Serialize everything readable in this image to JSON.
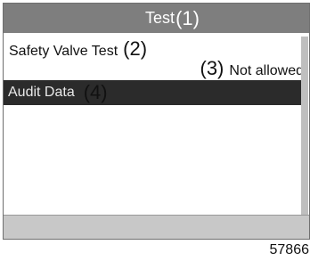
{
  "screen": {
    "title": "Test",
    "title_callout": "(1)",
    "items": {
      "safety_valve_test": {
        "label": "Safety Valve Test",
        "callout": "(2)",
        "status": "Not allowed",
        "status_callout": "(3)"
      },
      "audit_data": {
        "label": "Audit Data",
        "callout": "(4)",
        "selected": true
      }
    }
  },
  "figure_id": "57866",
  "colors": {
    "title_bar": "#7e7e7e",
    "selected_row": "#2b2b2b",
    "footer": "#c8c8c8"
  }
}
